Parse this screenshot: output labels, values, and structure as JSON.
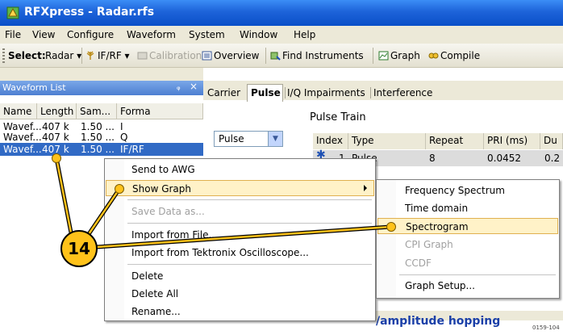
{
  "window": {
    "title": "RFXpress - Radar.rfs"
  },
  "menubar": [
    "File",
    "View",
    "Configure",
    "Waveform",
    "System",
    "Window",
    "Help"
  ],
  "toolbar": {
    "select_label": "Select:",
    "radar": "Radar",
    "ifrf": "IF/RF",
    "calibration": "Calibration",
    "overview": "Overview",
    "find_instruments": "Find Instruments",
    "graph": "Graph",
    "compile": "Compile"
  },
  "waveform_list": {
    "title": "Waveform List",
    "pin": "047",
    "columns": [
      "Name",
      "Length",
      "Sam...",
      "Forma"
    ],
    "rows": [
      [
        "Wavef...",
        "407 k",
        "1.50 ...",
        "I"
      ],
      [
        "Wavef...",
        "407 k",
        "1.50 ...",
        "Q"
      ],
      [
        "Wavef...",
        "407 k",
        "1.50 ...",
        "IF/RF"
      ]
    ]
  },
  "tabs": [
    "Carrier",
    "Pulse",
    "I/Q Impairments",
    "Interference"
  ],
  "pulse_panel": {
    "section_title": "Pulse Train",
    "dropdown_value": "Pulse",
    "columns": [
      "Index",
      "Type",
      "Repeat",
      "PRI (ms)",
      "Du"
    ],
    "row": [
      "1",
      "Pulse",
      "8",
      "0.0452",
      "0.2"
    ],
    "bottom_link": "/amplitude hopping"
  },
  "context_menu": [
    {
      "label": "Send to AWG"
    },
    {
      "label": "Show Graph"
    },
    {
      "label": "Save Data as..."
    },
    {
      "label": "Import from File..."
    },
    {
      "label": "Import from Tektronix Oscilloscope..."
    },
    {
      "label": "Delete"
    },
    {
      "label": "Delete All"
    },
    {
      "label": "Rename..."
    }
  ],
  "submenu": [
    {
      "label": "Frequency Spectrum"
    },
    {
      "label": "Time domain"
    },
    {
      "label": "Spectrogram"
    },
    {
      "label": "CPI Graph"
    },
    {
      "label": "CCDF"
    },
    {
      "label": "Graph Setup..."
    }
  ],
  "callout": {
    "number": "14"
  },
  "figure_code": "0159-104",
  "colors": {
    "title_bar": "#1d63d9",
    "callout": "#ffc21a",
    "selection": "#316ac5",
    "menu_highlight": "#fff2c8"
  }
}
